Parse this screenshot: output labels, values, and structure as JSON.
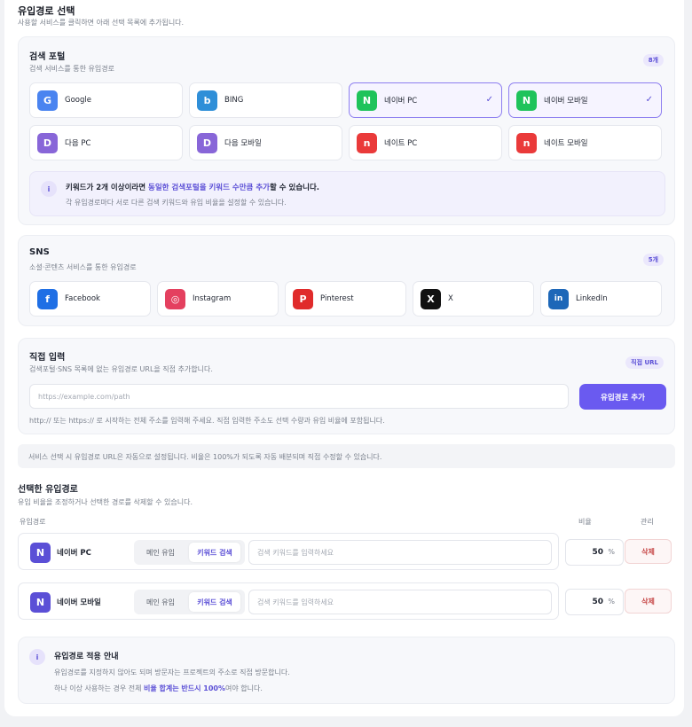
{
  "header": {
    "title": "유입경로 선택",
    "subtitle": "사용할 서비스를 클릭하면 아래 선택 목록에 추가됩니다."
  },
  "search_portal": {
    "title": "검색 포털",
    "subtitle": "검색 서비스를 통한 유입경로",
    "count": "8개",
    "items": [
      {
        "label": "Google",
        "logo": "G",
        "color": "#4a84f0",
        "selected": false
      },
      {
        "label": "BING",
        "logo": "b",
        "color": "#2f8fd8",
        "selected": false
      },
      {
        "label": "네이버 PC",
        "logo": "N",
        "color": "#1fc35b",
        "selected": true
      },
      {
        "label": "네이버 모바일",
        "logo": "N",
        "color": "#1fc35b",
        "selected": true
      },
      {
        "label": "다음 PC",
        "logo": "D",
        "color": "#8866d8",
        "selected": false
      },
      {
        "label": "다음 모바일",
        "logo": "D",
        "color": "#8866d8",
        "selected": false
      },
      {
        "label": "네이트 PC",
        "logo": "n",
        "color": "#ea3a3a",
        "selected": false
      },
      {
        "label": "네이트 모바일",
        "logo": "n",
        "color": "#ea3a3a",
        "selected": false
      }
    ],
    "check_mark": "✓",
    "info": {
      "icon": "i",
      "line_pre": "키워드가 2개 이상이라면 ",
      "line_highlight": "동일한 검색포털을 키워드 수만큼 추가",
      "line_post": "할 수 있습니다.",
      "desc": "각 유입경로마다 서로 다른 검색 키워드와 유입 비율을 설정할 수 있습니다."
    }
  },
  "sns": {
    "title": "SNS",
    "subtitle": "소셜·콘텐츠 서비스를 통한 유입경로",
    "count": "5개",
    "items": [
      {
        "label": "Facebook",
        "logo": "f",
        "color": "#1f6fe5"
      },
      {
        "label": "Instagram",
        "logo": "◎",
        "color": "#e4405f"
      },
      {
        "label": "Pinterest",
        "logo": "P",
        "color": "#e02b2b"
      },
      {
        "label": "X",
        "logo": "X",
        "color": "#111111"
      },
      {
        "label": "LinkedIn",
        "logo": "in",
        "color": "#1d67b8"
      }
    ]
  },
  "direct": {
    "title": "직접 입력",
    "subtitle": "검색포털·SNS 목록에 없는 유입경로 URL을 직접 추가합니다.",
    "badge": "직접 URL",
    "placeholder": "https://example.com/path",
    "button": "유입경로 추가",
    "hint": "http:// 또는 https:// 로 시작하는 전체 주소를 입력해 주세요. 직접 입력한 주소도 선택 수량과 유입 비율에 포함됩니다."
  },
  "notice": "서비스 선택 시 유입경로 URL은 자동으로 설정됩니다. 비율은 100%가 되도록 자동 배분되며 직접 수정할 수 있습니다.",
  "selected": {
    "title": "선택한 유입경로",
    "subtitle": "유입 비율을 조정하거나 선택한 경로를 삭제할 수 있습니다.",
    "col_route": "유입경로",
    "col_ratio": "비율",
    "col_manage": "관리",
    "rows": [
      {
        "logo": "N",
        "name": "네이버 PC",
        "mode_main": "메인 유입",
        "mode_keyword": "키워드 검색",
        "keyword_placeholder": "검색 키워드를 입력하세요",
        "ratio": "50",
        "unit": "%",
        "delete": "삭제"
      },
      {
        "logo": "N",
        "name": "네이버 모바일",
        "mode_main": "메인 유입",
        "mode_keyword": "키워드 검색",
        "keyword_placeholder": "검색 키워드를 입력하세요",
        "ratio": "50",
        "unit": "%",
        "delete": "삭제"
      }
    ]
  },
  "guide": {
    "icon": "i",
    "title": "유입경로 적용 안내",
    "line1": "유입경로를 지정하지 않아도 되며 방문자는 프로젝트의 주소로 직접 방문합니다.",
    "line2_pre": "하나 이상 사용하는 경우 전체 ",
    "line2_highlight": "비율 합계는 반드시 100%",
    "line2_post": "여야 합니다."
  },
  "colors": {
    "accent": "#6a5af0",
    "row_logo": "#5b4fd6",
    "danger": "#c64545"
  }
}
